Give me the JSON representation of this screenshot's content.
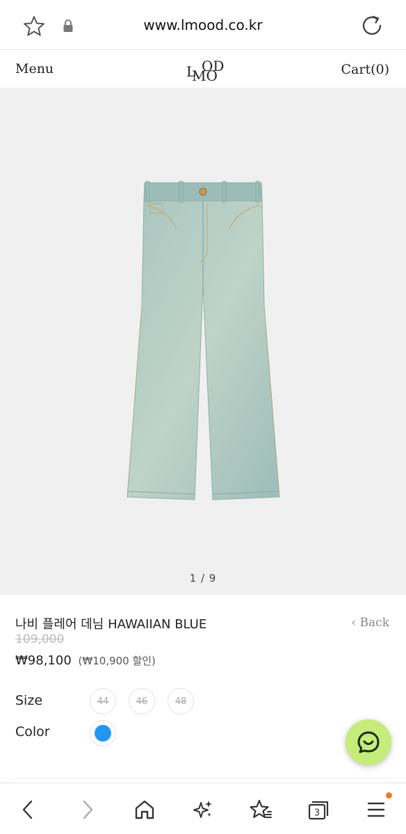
{
  "browser": {
    "url": "www.lmood.co.kr",
    "tab_count": "3"
  },
  "header": {
    "menu_label": "Menu",
    "logo_letters": [
      "L",
      "OD",
      "MO"
    ],
    "cart_label": "Cart(0)"
  },
  "gallery": {
    "pager": "1 / 9",
    "current_image": 1,
    "total_images": 9
  },
  "product": {
    "title": "나비 플레어 데님 HAWAIIAN BLUE",
    "back_label": "Back",
    "original_price": "109,000",
    "sale_price": "₩98,100",
    "discount_text": "(₩10,900 할인)",
    "size_label": "Size",
    "sizes": [
      "44",
      "46",
      "48"
    ],
    "color_label": "Color",
    "color_swatch": "#2196f3"
  },
  "colors": {
    "gallery_bg": "#f0f0f0",
    "chat_button": "#c6ec7b",
    "badge": "#f07a2a"
  },
  "icons": {
    "urlbar": [
      "star-icon",
      "lock-icon",
      "reload-icon"
    ],
    "bottom_nav": [
      "back-arrow-icon",
      "forward-arrow-icon",
      "home-icon",
      "sparkle-icon",
      "bookmark-star-icon",
      "tabs-icon",
      "menu-icon"
    ],
    "chat": "chat-icon"
  }
}
